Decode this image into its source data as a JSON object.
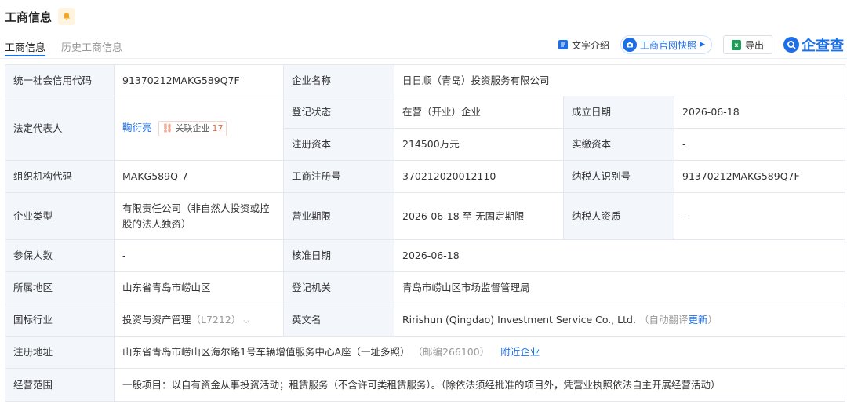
{
  "header": {
    "title": "工商信息",
    "tabs": [
      {
        "label": "工商信息",
        "active": true
      },
      {
        "label": "历史工商信息",
        "active": false
      }
    ],
    "toolbar": {
      "text_intro": "文字介绍",
      "snapshot": "工商官网快照",
      "export": "导出",
      "logo": "企查查"
    }
  },
  "colors": {
    "accent": "#1d6fe8",
    "label_bg": "#f3f6fb",
    "border": "#e4e8ee",
    "assoc_count": "#e8663a"
  },
  "rows": {
    "credit_code": {
      "label": "统一社会信用代码",
      "value": "91370212MAKG589Q7F"
    },
    "company_name": {
      "label": "企业名称",
      "value": "日日顺（青岛）投资服务有限公司"
    },
    "legal_rep": {
      "label": "法定代表人",
      "value": "鞠衍亮",
      "assoc_label": "关联企业",
      "assoc_count": "17"
    },
    "reg_status": {
      "label": "登记状态",
      "value": "在营（开业）企业"
    },
    "est_date": {
      "label": "成立日期",
      "value": "2026-06-18"
    },
    "reg_capital": {
      "label": "注册资本",
      "value": "214500万元"
    },
    "paid_capital": {
      "label": "实缴资本",
      "value": "-"
    },
    "org_code": {
      "label": "组织机构代码",
      "value": "MAKG589Q-7"
    },
    "biz_reg_no": {
      "label": "工商注册号",
      "value": "370212020012110"
    },
    "taxpayer_id": {
      "label": "纳税人识别号",
      "value": "91370212MAKG589Q7F"
    },
    "company_type": {
      "label": "企业类型",
      "value": "有限责任公司（非自然人投资或控股的法人独资）"
    },
    "biz_term": {
      "label": "营业期限",
      "value": "2026-06-18 至 无固定期限"
    },
    "taxpayer_qual": {
      "label": "纳税人资质",
      "value": "-"
    },
    "insured": {
      "label": "参保人数",
      "value": "-"
    },
    "approval_date": {
      "label": "核准日期",
      "value": "2026-06-18"
    },
    "region": {
      "label": "所属地区",
      "value": "山东省青岛市崂山区"
    },
    "reg_authority": {
      "label": "登记机关",
      "value": "青岛市崂山区市场监督管理局"
    },
    "industry": {
      "label": "国标行业",
      "value": "投资与资产管理",
      "code": "（L7212）"
    },
    "english_name": {
      "label": "英文名",
      "value": "Ririshun (Qingdao) Investment Service Co., Ltd.",
      "note_prefix": "（自动翻译",
      "note_link": "更新",
      "note_suffix": "）"
    },
    "address": {
      "label": "注册地址",
      "value": "山东省青岛市崂山区海尔路1号车辆增值服务中心A座（一址多照）",
      "postal": "（邮编266100）",
      "nearby": "附近企业"
    },
    "scope": {
      "label": "经营范围",
      "value": "一般项目：以自有资金从事投资活动；租赁服务（不含许可类租赁服务）。（除依法须经批准的项目外，凭营业执照依法自主开展经营活动）"
    }
  }
}
